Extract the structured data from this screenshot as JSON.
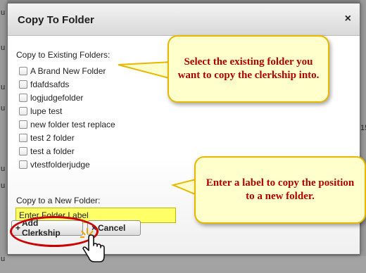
{
  "dialog": {
    "title": "Copy To Folder",
    "close_label": "×"
  },
  "existing": {
    "label": "Copy to Existing Folders:",
    "folders": [
      "A Brand New Folder",
      "fdafdsafds",
      "logjudgefolder",
      "lupe test",
      "new folder test replace",
      "test 2 folder",
      "test a folder",
      "vtestfolderjudge"
    ]
  },
  "new_folder": {
    "label": "Copy to a New Folder:",
    "value": "Enter Folder Label"
  },
  "buttons": {
    "add_label": "Add Clerkship",
    "add_glyph": "+",
    "cancel_label": "Cancel",
    "cancel_glyph": "×"
  },
  "callouts": {
    "existing_tip": "Select the existing folder you want to copy the clerkship into.",
    "new_tip": "Enter a label to copy the position to a new folder."
  },
  "background": {
    "left_chars": [
      "u",
      "u",
      "u",
      "u",
      "u",
      "u",
      "u"
    ],
    "right_chars": [
      "15",
      "15"
    ]
  },
  "colors": {
    "callout_text": "#b00000",
    "callout_border": "#e6b800",
    "input_highlight": "#ffff66",
    "oval": "#cc0000"
  }
}
